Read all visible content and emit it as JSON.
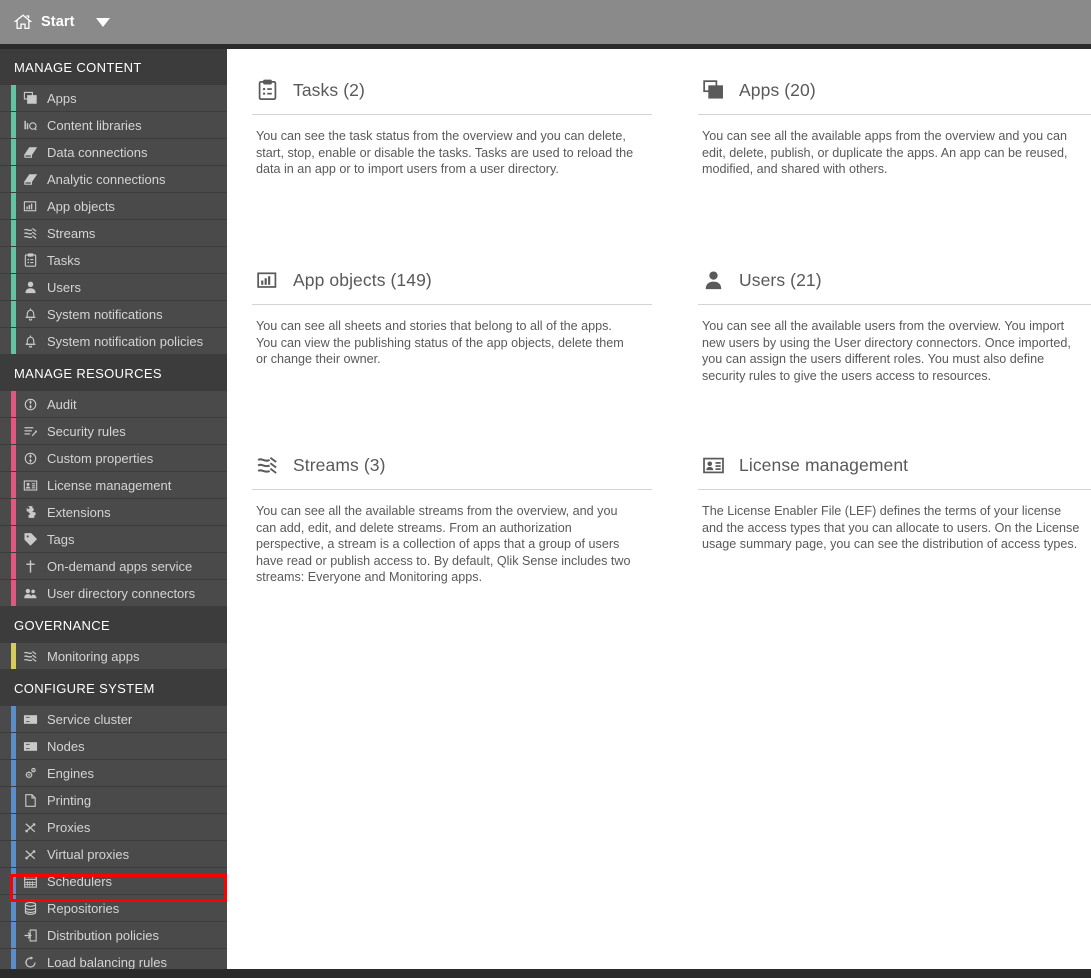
{
  "topbar": {
    "home_icon": "home-icon",
    "start_label": "Start",
    "dropdown_icon": "chevron-down-icon"
  },
  "sidebar": {
    "sections": [
      {
        "id": "manage-content",
        "title": "MANAGE CONTENT",
        "accent": "#61c3a0",
        "items": [
          {
            "label": "Apps",
            "icon": "apps-icon"
          },
          {
            "label": "Content libraries",
            "icon": "content-libraries-icon"
          },
          {
            "label": "Data connections",
            "icon": "data-connections-icon"
          },
          {
            "label": "Analytic connections",
            "icon": "analytic-connections-icon"
          },
          {
            "label": "App objects",
            "icon": "app-objects-icon"
          },
          {
            "label": "Streams",
            "icon": "streams-icon"
          },
          {
            "label": "Tasks",
            "icon": "tasks-icon"
          },
          {
            "label": "Users",
            "icon": "users-icon"
          },
          {
            "label": "System notifications",
            "icon": "bell-icon"
          },
          {
            "label": "System notification policies",
            "icon": "bell-icon"
          }
        ]
      },
      {
        "id": "manage-resources",
        "title": "MANAGE RESOURCES",
        "accent": "#e0577f",
        "items": [
          {
            "label": "Audit",
            "icon": "audit-icon"
          },
          {
            "label": "Security rules",
            "icon": "security-rules-icon"
          },
          {
            "label": "Custom properties",
            "icon": "custom-properties-icon"
          },
          {
            "label": "License management",
            "icon": "license-card-icon"
          },
          {
            "label": "Extensions",
            "icon": "extensions-puzzle-icon"
          },
          {
            "label": "Tags",
            "icon": "tag-icon"
          },
          {
            "label": "On-demand apps service",
            "icon": "on-demand-icon"
          },
          {
            "label": "User directory connectors",
            "icon": "user-directory-icon"
          }
        ]
      },
      {
        "id": "governance",
        "title": "GOVERNANCE",
        "accent": "#d6cc5c",
        "items": [
          {
            "label": "Monitoring apps",
            "icon": "streams-icon"
          }
        ]
      },
      {
        "id": "configure-system",
        "title": "CONFIGURE SYSTEM",
        "accent": "#5b8dc8",
        "items": [
          {
            "label": "Service cluster",
            "icon": "server-icon"
          },
          {
            "label": "Nodes",
            "icon": "server-icon"
          },
          {
            "label": "Engines",
            "icon": "engines-gear-icon"
          },
          {
            "label": "Printing",
            "icon": "printing-page-icon"
          },
          {
            "label": "Proxies",
            "icon": "proxies-icon"
          },
          {
            "label": "Virtual proxies",
            "icon": "proxies-icon"
          },
          {
            "label": "Schedulers",
            "icon": "schedulers-calendar-icon"
          },
          {
            "label": "Repositories",
            "icon": "repositories-database-icon"
          },
          {
            "label": "Distribution policies",
            "icon": "distribution-policies-icon"
          },
          {
            "label": "Load balancing rules",
            "icon": "load-balancing-icon"
          }
        ]
      }
    ],
    "highlight": {
      "target": "Schedulers",
      "color": "#ff0000"
    }
  },
  "main": {
    "cards": [
      {
        "title": "Tasks (2)",
        "icon": "tasks-icon",
        "body": "You can see the task status from the overview and you can delete, start, stop, enable or disable the tasks. Tasks are used to reload the data in an app or to import users from a user directory."
      },
      {
        "title": "Apps (20)",
        "icon": "apps-icon",
        "body": "You can see all the available apps from the overview and you can edit, delete, publish, or duplicate the apps. An app can be reused, modified, and shared with others."
      },
      {
        "title": "App objects (149)",
        "icon": "app-objects-icon",
        "body": "You can see all sheets and stories that belong to all of the apps. You can view the publishing status of the app objects, delete them or change their owner."
      },
      {
        "title": "Users (21)",
        "icon": "users-icon",
        "body": "You can see all the available users from the overview. You import new users by using the User directory connectors. Once imported, you can assign the users different roles. You must also define security rules to give the users access to resources."
      },
      {
        "title": "Streams (3)",
        "icon": "streams-icon",
        "body": "You can see all the available streams from the overview, and you can add, edit, and delete streams. From an authorization perspective, a stream is a collection of apps that a group of users have read or publish access to. By default, Qlik Sense includes two streams: Everyone and Monitoring apps."
      },
      {
        "title": "License management",
        "icon": "license-card-icon",
        "body": "The License Enabler File (LEF) defines the terms of your license and the access types that you can allocate to users. On the License usage summary page, you can see the distribution of access types."
      }
    ]
  },
  "colors": {
    "topbar_bg": "#8a8a8a",
    "sidebar_item_bg": "#4a4a4a",
    "sidebar_header_bg": "#3c3c3c",
    "sidebar_edge_bg": "#2b2b2b",
    "text_light": "#d4d4d4",
    "content_text": "#595959",
    "highlight_red": "#ff0000"
  }
}
